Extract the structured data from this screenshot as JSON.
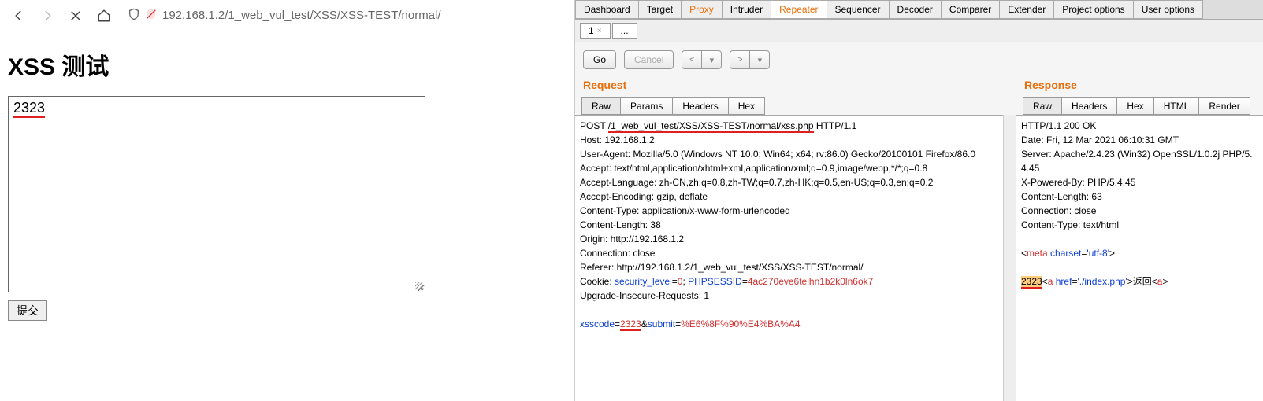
{
  "browser": {
    "url": "192.168.1.2/1_web_vul_test/XSS/XSS-TEST/normal/"
  },
  "page": {
    "title": "XSS 测试",
    "textarea_value": "2323",
    "submit_label": "提交"
  },
  "burp": {
    "top_tabs": [
      "Dashboard",
      "Target",
      "Proxy",
      "Intruder",
      "Repeater",
      "Sequencer",
      "Decoder",
      "Comparer",
      "Extender",
      "Project options",
      "User options"
    ],
    "active_top": "Repeater",
    "proxy_orange": "Proxy",
    "sub_tabs": {
      "tab1": "1",
      "more": "..."
    },
    "actions": {
      "go": "Go",
      "cancel": "Cancel"
    },
    "request": {
      "title": "Request",
      "view_tabs": [
        "Raw",
        "Params",
        "Headers",
        "Hex"
      ],
      "lines": [
        {
          "pre": "POST ",
          "mid": "/1_web_vul_test/XSS/XSS-TEST/normal/xss.php",
          "post": " HTTP/1.1"
        },
        "Host: 192.168.1.2",
        "User-Agent: Mozilla/5.0 (Windows NT 10.0; Win64; x64; rv:86.0) Gecko/20100101 Firefox/86.0",
        "Accept: text/html,application/xhtml+xml,application/xml;q=0.9,image/webp,*/*;q=0.8",
        "Accept-Language: zh-CN,zh;q=0.8,zh-TW;q=0.7,zh-HK;q=0.5,en-US;q=0.3,en;q=0.2",
        "Accept-Encoding: gzip, deflate",
        "Content-Type: application/x-www-form-urlencoded",
        "Content-Length: 38",
        "Origin: http://192.168.1.2",
        "Connection: close",
        "Referer: http://192.168.1.2/1_web_vul_test/XSS/XSS-TEST/normal/"
      ],
      "cookie": {
        "prefix": "Cookie: ",
        "k1": "security_level",
        "v1": "0",
        "k2": "PHPSESSID",
        "v2": "4ac270eve6telhn1b2k0ln6ok7"
      },
      "upgrade": "Upgrade-Insecure-Requests: 1",
      "formbody": {
        "k1": "xsscode",
        "v1": "2323",
        "k2": "submit",
        "v2": "%E6%8F%90%E4%BA%A4"
      }
    },
    "response": {
      "title": "Response",
      "view_tabs": [
        "Raw",
        "Headers",
        "Hex",
        "HTML",
        "Render"
      ],
      "headers": [
        "HTTP/1.1 200 OK",
        "Date: Fri, 12 Mar 2021 06:10:31 GMT",
        "Server: Apache/2.4.23 (Win32) OpenSSL/1.0.2j PHP/5.4.45",
        "X-Powered-By: PHP/5.4.45",
        "Content-Length: 63",
        "Connection: close",
        "Content-Type: text/html"
      ],
      "meta": {
        "open": "<",
        "tag": "meta",
        "attr": "charset",
        "val": "'utf-8'",
        "close": ">"
      },
      "body": {
        "hl": "2323",
        "open": "<",
        "a": "a",
        "href": "href",
        "path": "'./index.php'",
        "gt": ">",
        "txt": "返回",
        "open2": "<",
        "a2": "a",
        "gt2": ">"
      }
    }
  }
}
